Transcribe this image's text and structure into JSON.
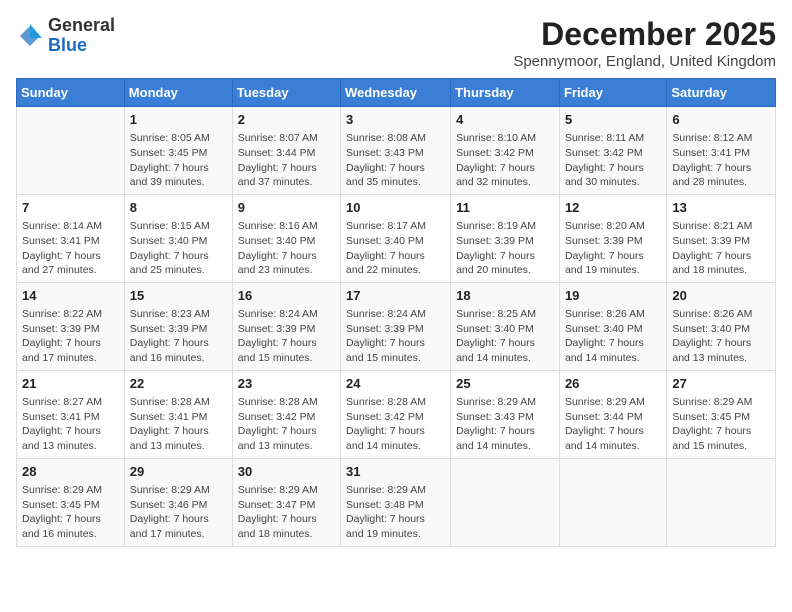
{
  "logo": {
    "general": "General",
    "blue": "Blue"
  },
  "title": {
    "month_year": "December 2025",
    "location": "Spennymoor, England, United Kingdom"
  },
  "days_of_week": [
    "Sunday",
    "Monday",
    "Tuesday",
    "Wednesday",
    "Thursday",
    "Friday",
    "Saturday"
  ],
  "weeks": [
    [
      {
        "day": "",
        "sunrise": "",
        "sunset": "",
        "daylight": ""
      },
      {
        "day": "1",
        "sunrise": "Sunrise: 8:05 AM",
        "sunset": "Sunset: 3:45 PM",
        "daylight": "Daylight: 7 hours and 39 minutes."
      },
      {
        "day": "2",
        "sunrise": "Sunrise: 8:07 AM",
        "sunset": "Sunset: 3:44 PM",
        "daylight": "Daylight: 7 hours and 37 minutes."
      },
      {
        "day": "3",
        "sunrise": "Sunrise: 8:08 AM",
        "sunset": "Sunset: 3:43 PM",
        "daylight": "Daylight: 7 hours and 35 minutes."
      },
      {
        "day": "4",
        "sunrise": "Sunrise: 8:10 AM",
        "sunset": "Sunset: 3:42 PM",
        "daylight": "Daylight: 7 hours and 32 minutes."
      },
      {
        "day": "5",
        "sunrise": "Sunrise: 8:11 AM",
        "sunset": "Sunset: 3:42 PM",
        "daylight": "Daylight: 7 hours and 30 minutes."
      },
      {
        "day": "6",
        "sunrise": "Sunrise: 8:12 AM",
        "sunset": "Sunset: 3:41 PM",
        "daylight": "Daylight: 7 hours and 28 minutes."
      }
    ],
    [
      {
        "day": "7",
        "sunrise": "Sunrise: 8:14 AM",
        "sunset": "Sunset: 3:41 PM",
        "daylight": "Daylight: 7 hours and 27 minutes."
      },
      {
        "day": "8",
        "sunrise": "Sunrise: 8:15 AM",
        "sunset": "Sunset: 3:40 PM",
        "daylight": "Daylight: 7 hours and 25 minutes."
      },
      {
        "day": "9",
        "sunrise": "Sunrise: 8:16 AM",
        "sunset": "Sunset: 3:40 PM",
        "daylight": "Daylight: 7 hours and 23 minutes."
      },
      {
        "day": "10",
        "sunrise": "Sunrise: 8:17 AM",
        "sunset": "Sunset: 3:40 PM",
        "daylight": "Daylight: 7 hours and 22 minutes."
      },
      {
        "day": "11",
        "sunrise": "Sunrise: 8:19 AM",
        "sunset": "Sunset: 3:39 PM",
        "daylight": "Daylight: 7 hours and 20 minutes."
      },
      {
        "day": "12",
        "sunrise": "Sunrise: 8:20 AM",
        "sunset": "Sunset: 3:39 PM",
        "daylight": "Daylight: 7 hours and 19 minutes."
      },
      {
        "day": "13",
        "sunrise": "Sunrise: 8:21 AM",
        "sunset": "Sunset: 3:39 PM",
        "daylight": "Daylight: 7 hours and 18 minutes."
      }
    ],
    [
      {
        "day": "14",
        "sunrise": "Sunrise: 8:22 AM",
        "sunset": "Sunset: 3:39 PM",
        "daylight": "Daylight: 7 hours and 17 minutes."
      },
      {
        "day": "15",
        "sunrise": "Sunrise: 8:23 AM",
        "sunset": "Sunset: 3:39 PM",
        "daylight": "Daylight: 7 hours and 16 minutes."
      },
      {
        "day": "16",
        "sunrise": "Sunrise: 8:24 AM",
        "sunset": "Sunset: 3:39 PM",
        "daylight": "Daylight: 7 hours and 15 minutes."
      },
      {
        "day": "17",
        "sunrise": "Sunrise: 8:24 AM",
        "sunset": "Sunset: 3:39 PM",
        "daylight": "Daylight: 7 hours and 15 minutes."
      },
      {
        "day": "18",
        "sunrise": "Sunrise: 8:25 AM",
        "sunset": "Sunset: 3:40 PM",
        "daylight": "Daylight: 7 hours and 14 minutes."
      },
      {
        "day": "19",
        "sunrise": "Sunrise: 8:26 AM",
        "sunset": "Sunset: 3:40 PM",
        "daylight": "Daylight: 7 hours and 14 minutes."
      },
      {
        "day": "20",
        "sunrise": "Sunrise: 8:26 AM",
        "sunset": "Sunset: 3:40 PM",
        "daylight": "Daylight: 7 hours and 13 minutes."
      }
    ],
    [
      {
        "day": "21",
        "sunrise": "Sunrise: 8:27 AM",
        "sunset": "Sunset: 3:41 PM",
        "daylight": "Daylight: 7 hours and 13 minutes."
      },
      {
        "day": "22",
        "sunrise": "Sunrise: 8:28 AM",
        "sunset": "Sunset: 3:41 PM",
        "daylight": "Daylight: 7 hours and 13 minutes."
      },
      {
        "day": "23",
        "sunrise": "Sunrise: 8:28 AM",
        "sunset": "Sunset: 3:42 PM",
        "daylight": "Daylight: 7 hours and 13 minutes."
      },
      {
        "day": "24",
        "sunrise": "Sunrise: 8:28 AM",
        "sunset": "Sunset: 3:42 PM",
        "daylight": "Daylight: 7 hours and 14 minutes."
      },
      {
        "day": "25",
        "sunrise": "Sunrise: 8:29 AM",
        "sunset": "Sunset: 3:43 PM",
        "daylight": "Daylight: 7 hours and 14 minutes."
      },
      {
        "day": "26",
        "sunrise": "Sunrise: 8:29 AM",
        "sunset": "Sunset: 3:44 PM",
        "daylight": "Daylight: 7 hours and 14 minutes."
      },
      {
        "day": "27",
        "sunrise": "Sunrise: 8:29 AM",
        "sunset": "Sunset: 3:45 PM",
        "daylight": "Daylight: 7 hours and 15 minutes."
      }
    ],
    [
      {
        "day": "28",
        "sunrise": "Sunrise: 8:29 AM",
        "sunset": "Sunset: 3:45 PM",
        "daylight": "Daylight: 7 hours and 16 minutes."
      },
      {
        "day": "29",
        "sunrise": "Sunrise: 8:29 AM",
        "sunset": "Sunset: 3:46 PM",
        "daylight": "Daylight: 7 hours and 17 minutes."
      },
      {
        "day": "30",
        "sunrise": "Sunrise: 8:29 AM",
        "sunset": "Sunset: 3:47 PM",
        "daylight": "Daylight: 7 hours and 18 minutes."
      },
      {
        "day": "31",
        "sunrise": "Sunrise: 8:29 AM",
        "sunset": "Sunset: 3:48 PM",
        "daylight": "Daylight: 7 hours and 19 minutes."
      },
      {
        "day": "",
        "sunrise": "",
        "sunset": "",
        "daylight": ""
      },
      {
        "day": "",
        "sunrise": "",
        "sunset": "",
        "daylight": ""
      },
      {
        "day": "",
        "sunrise": "",
        "sunset": "",
        "daylight": ""
      }
    ]
  ]
}
